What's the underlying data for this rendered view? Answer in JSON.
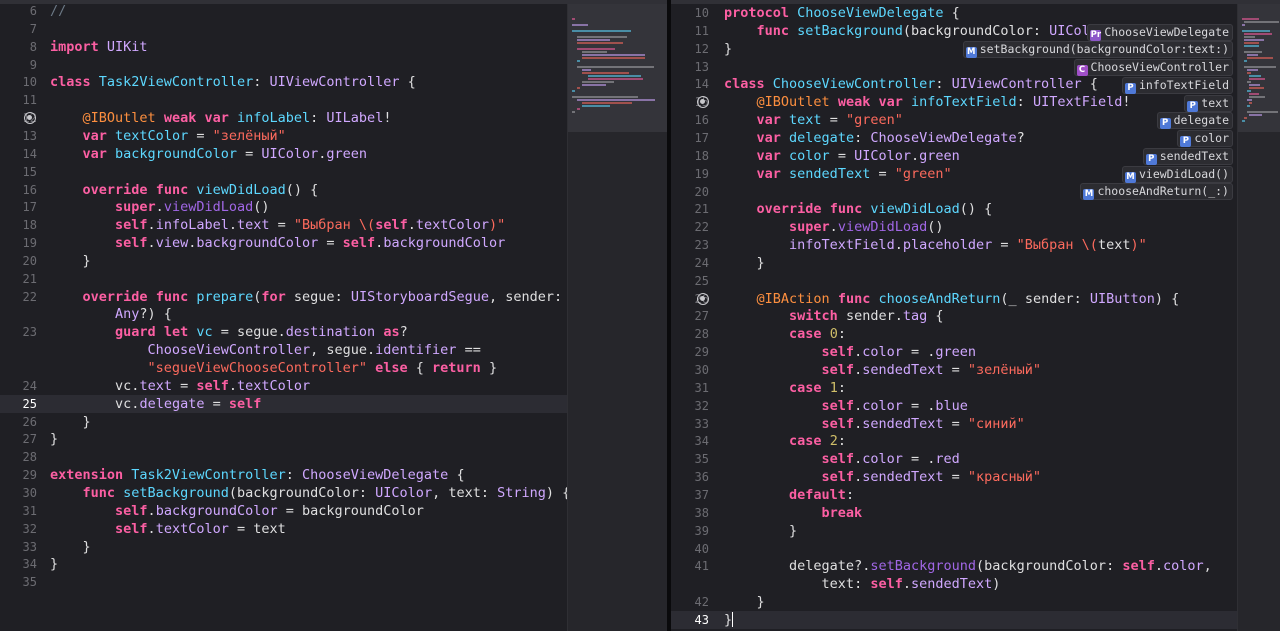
{
  "left_editor": {
    "lines": [
      {
        "n": "6",
        "code": "//"
      },
      {
        "n": "7",
        "code": ""
      },
      {
        "n": "8",
        "code": "import UIKit"
      },
      {
        "n": "9",
        "code": ""
      },
      {
        "n": "10",
        "code": "class Task2ViewController: UIViewController {"
      },
      {
        "n": "11",
        "code": ""
      },
      {
        "n": "12",
        "code": "    @IBOutlet weak var infoLabel: UILabel!",
        "bp": true
      },
      {
        "n": "13",
        "code": "    var textColor = \"зелёный\""
      },
      {
        "n": "14",
        "code": "    var backgroundColor = UIColor.green"
      },
      {
        "n": "15",
        "code": ""
      },
      {
        "n": "16",
        "code": "    override func viewDidLoad() {"
      },
      {
        "n": "17",
        "code": "        super.viewDidLoad()"
      },
      {
        "n": "18",
        "code": "        self.infoLabel.text = \"Выбран \\(self.textColor)\""
      },
      {
        "n": "19",
        "code": "        self.view.backgroundColor = self.backgroundColor"
      },
      {
        "n": "20",
        "code": "    }"
      },
      {
        "n": "21",
        "code": ""
      },
      {
        "n": "22",
        "code": "    override func prepare(for segue: UIStoryboardSegue, sender:"
      },
      {
        "n": "",
        "code": "        Any?) {"
      },
      {
        "n": "23",
        "code": "        guard let vc = segue.destination as?"
      },
      {
        "n": "",
        "code": "            ChooseViewController, segue.identifier =="
      },
      {
        "n": "",
        "code": "            \"segueViewChooseController\" else { return }"
      },
      {
        "n": "24",
        "code": "        vc.text = self.textColor"
      },
      {
        "n": "25",
        "code": "        vc.delegate = self",
        "current": true
      },
      {
        "n": "26",
        "code": "    }"
      },
      {
        "n": "27",
        "code": "}"
      },
      {
        "n": "28",
        "code": ""
      },
      {
        "n": "29",
        "code": "extension Task2ViewController: ChooseViewDelegate {"
      },
      {
        "n": "30",
        "code": "    func setBackground(backgroundColor: UIColor, text: String) {"
      },
      {
        "n": "31",
        "code": "        self.backgroundColor = backgroundColor"
      },
      {
        "n": "32",
        "code": "        self.textColor = text"
      },
      {
        "n": "33",
        "code": "    }"
      },
      {
        "n": "34",
        "code": "}"
      },
      {
        "n": "35",
        "code": ""
      }
    ]
  },
  "right_editor": {
    "lines": [
      {
        "n": "10",
        "code": "protocol ChooseViewDelegate {"
      },
      {
        "n": "11",
        "code": "    func setBackground(backgroundColor: UIColor, text: String)"
      },
      {
        "n": "12",
        "code": "}"
      },
      {
        "n": "13",
        "code": ""
      },
      {
        "n": "14",
        "code": "class ChooseViewController: UIViewController {"
      },
      {
        "n": "15",
        "code": "    @IBOutlet weak var infoTextField: UITextField!",
        "bp": true
      },
      {
        "n": "16",
        "code": "    var text = \"green\""
      },
      {
        "n": "17",
        "code": "    var delegate: ChooseViewDelegate?"
      },
      {
        "n": "18",
        "code": "    var color = UIColor.green"
      },
      {
        "n": "19",
        "code": "    var sendedText = \"green\""
      },
      {
        "n": "20",
        "code": ""
      },
      {
        "n": "21",
        "code": "    override func viewDidLoad() {"
      },
      {
        "n": "22",
        "code": "        super.viewDidLoad()"
      },
      {
        "n": "23",
        "code": "        infoTextField.placeholder = \"Выбран \\(text)\""
      },
      {
        "n": "24",
        "code": "    }"
      },
      {
        "n": "25",
        "code": ""
      },
      {
        "n": "26",
        "code": "    @IBAction func chooseAndReturn(_ sender: UIButton) {",
        "bp": true
      },
      {
        "n": "27",
        "code": "        switch sender.tag {"
      },
      {
        "n": "28",
        "code": "        case 0:"
      },
      {
        "n": "29",
        "code": "            self.color = .green"
      },
      {
        "n": "30",
        "code": "            self.sendedText = \"зелёный\""
      },
      {
        "n": "31",
        "code": "        case 1:"
      },
      {
        "n": "32",
        "code": "            self.color = .blue"
      },
      {
        "n": "33",
        "code": "            self.sendedText = \"синий\""
      },
      {
        "n": "34",
        "code": "        case 2:"
      },
      {
        "n": "35",
        "code": "            self.color = .red"
      },
      {
        "n": "36",
        "code": "            self.sendedText = \"красный\""
      },
      {
        "n": "37",
        "code": "        default:"
      },
      {
        "n": "38",
        "code": "            break"
      },
      {
        "n": "39",
        "code": "        }"
      },
      {
        "n": "40",
        "code": ""
      },
      {
        "n": "41",
        "code": "        delegate?.setBackground(backgroundColor: self.color,"
      },
      {
        "n": "",
        "code": "            text: self.sendedText)"
      },
      {
        "n": "42",
        "code": "    }"
      },
      {
        "n": "43",
        "code": "}",
        "current": true,
        "caret": true
      }
    ]
  },
  "symbol_badges": [
    {
      "icon": "Pr",
      "kind": "protocol",
      "label": "ChooseViewDelegate"
    },
    {
      "icon": "M",
      "kind": "method",
      "label": "setBackground(backgroundColor:text:)"
    },
    {
      "icon": "C",
      "kind": "class",
      "label": "ChooseViewController"
    },
    {
      "icon": "P",
      "kind": "property",
      "label": "infoTextField"
    },
    {
      "icon": "P",
      "kind": "property",
      "label": "text"
    },
    {
      "icon": "P",
      "kind": "property",
      "label": "delegate"
    },
    {
      "icon": "P",
      "kind": "property",
      "label": "color"
    },
    {
      "icon": "P",
      "kind": "property",
      "label": "sendedText"
    },
    {
      "icon": "M",
      "kind": "method",
      "label": "viewDidLoad()"
    },
    {
      "icon": "M",
      "kind": "method",
      "label": "chooseAndReturn(_:)"
    }
  ],
  "colors": {
    "background": "#1f1f24",
    "keyword": "#fc5fa3",
    "string": "#fc6a5d",
    "type": "#d0a8ff",
    "type_declaration": "#5dd8ff",
    "function": "#a167e6",
    "number": "#d0bf69",
    "attribute": "#fd8f3f",
    "plain": "#dfdfe0",
    "line_number": "#6c6c72"
  }
}
